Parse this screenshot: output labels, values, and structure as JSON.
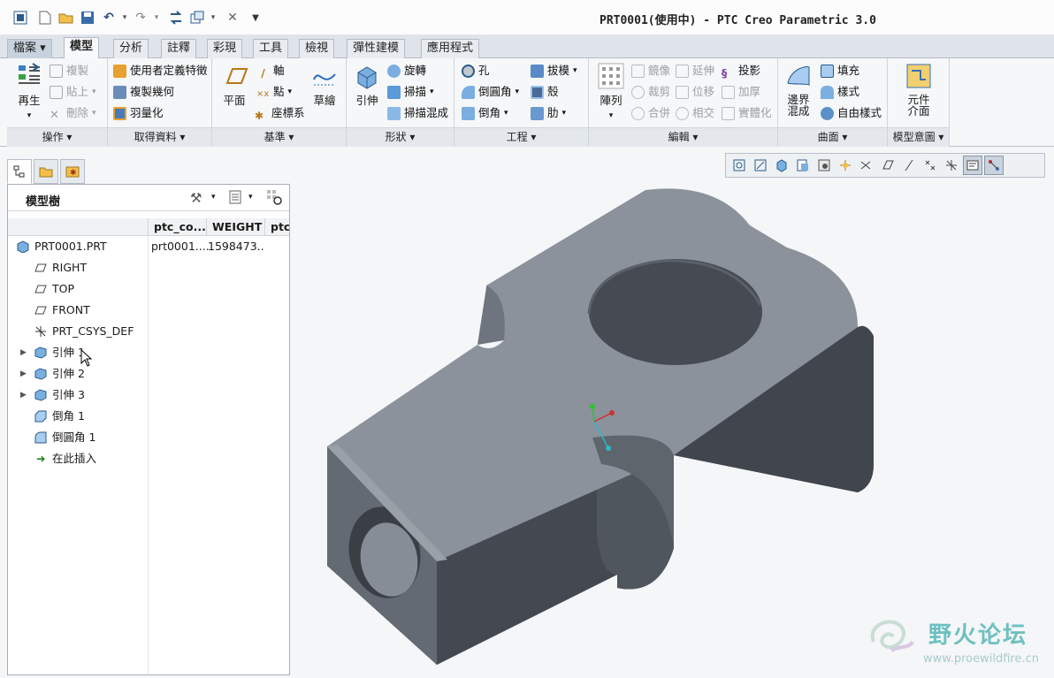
{
  "window": {
    "title": "PRT0001(使用中) - PTC Creo Parametric 3.0"
  },
  "quick_access": [
    "window-icon",
    "new-icon",
    "open-icon",
    "save-icon",
    "undo-icon",
    "redo-icon",
    "regenerate-icon",
    "windows-icon",
    "close-icon",
    "customize-icon"
  ],
  "tabs": [
    "檔案",
    "模型",
    "分析",
    "註釋",
    "彩現",
    "工具",
    "檢視",
    "彈性建模",
    "應用程式"
  ],
  "active_tab": "模型",
  "ribbon": {
    "ops": {
      "label": "操作",
      "regen": "再生",
      "copy": "複製",
      "paste": "貼上",
      "delete": "刪除"
    },
    "getdata": {
      "label": "取得資料",
      "udf": "使用者定義特徵",
      "copygeom": "複製幾何",
      "shrink": "羽量化"
    },
    "datum": {
      "label": "基準",
      "plane": "平面",
      "axis": "軸",
      "point": "點",
      "csys": "座標系",
      "sketch": "草繪"
    },
    "shapes": {
      "label": "形狀",
      "extrude": "引伸",
      "revolve": "旋轉",
      "sweep": "掃描",
      "sweptblend": "掃描混成"
    },
    "eng": {
      "label": "工程",
      "hole": "孔",
      "round": "倒圓角",
      "chamfer": "倒角",
      "draft": "拔模",
      "shell": "殼",
      "rib": "肋"
    },
    "edit": {
      "label": "編輯",
      "pattern": "陣列",
      "mirror": "鏡像",
      "extend": "延伸",
      "project": "投影",
      "trim": "裁剪",
      "offset": "位移",
      "thicken": "加厚",
      "merge": "合併",
      "intersect": "相交",
      "solidify": "實體化"
    },
    "surfaces": {
      "label": "曲面",
      "boundary": "邊界\n混成",
      "fill": "填充",
      "style": "樣式",
      "freestyle": "自由樣式"
    },
    "intent": {
      "label": "模型意圖",
      "component": "元件\n介面"
    }
  },
  "tree": {
    "title": "模型樹",
    "columns": [
      "ptc_co...",
      "WEIGHT",
      "ptc_"
    ],
    "items": [
      {
        "label": "PRT0001.PRT",
        "c1": "prt0001....",
        "c2": "1598473...",
        "icon": "part-icon"
      },
      {
        "label": "RIGHT",
        "icon": "datum-plane-icon"
      },
      {
        "label": "TOP",
        "icon": "datum-plane-icon"
      },
      {
        "label": "FRONT",
        "icon": "datum-plane-icon"
      },
      {
        "label": "PRT_CSYS_DEF",
        "icon": "csys-icon"
      },
      {
        "label": "引伸 1",
        "icon": "extrude-icon",
        "expandable": true
      },
      {
        "label": "引伸 2",
        "icon": "extrude-icon",
        "expandable": true
      },
      {
        "label": "引伸 3",
        "icon": "extrude-icon",
        "expandable": true
      },
      {
        "label": "倒角 1",
        "icon": "chamfer-icon"
      },
      {
        "label": "倒圓角 1",
        "icon": "round-icon"
      },
      {
        "label": "在此插入",
        "icon": "insert-here-icon"
      }
    ]
  },
  "view_toolbar": [
    "refit-icon",
    "zoom-in-icon",
    "repaint-icon",
    "display-style-icon",
    "saved-orientations-icon",
    "view-manager-icon",
    "plane-display-icon",
    "axis-display-icon",
    "point-display-icon",
    "csys-display-icon",
    "spin-center-icon",
    "annotation-display-icon",
    "datum-display-filter-icon"
  ],
  "watermark": {
    "title": "野火论坛",
    "url": "www.proewildfire.cn"
  },
  "colors": {
    "accent": "#2b5a8c",
    "part_top": "#8c939c",
    "part_side": "#40454d"
  }
}
